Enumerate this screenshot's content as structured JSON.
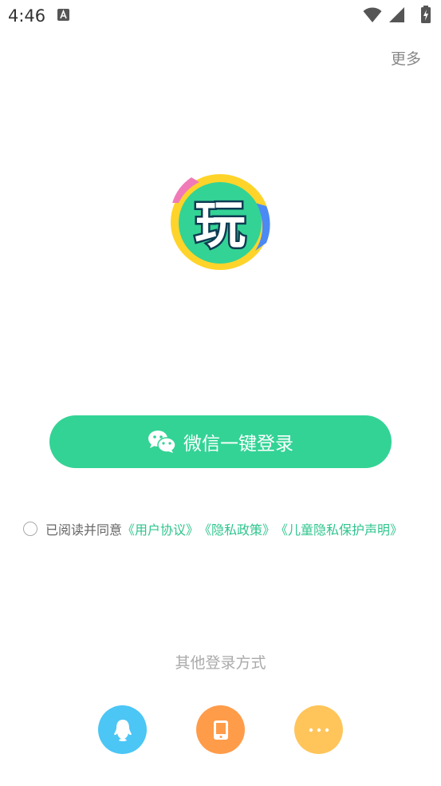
{
  "status_bar": {
    "time": "4:46",
    "indicator_icon": "text-a-icon",
    "right_icons": [
      "wifi-icon",
      "signal-icon",
      "battery-icon"
    ]
  },
  "header": {
    "more_label": "更多"
  },
  "logo": {
    "glyph": "玩",
    "colors": {
      "ring_yellow": "#ffd42a",
      "ring_pink": "#f07ab8",
      "ring_blue": "#4b89f5",
      "inner_green": "#33d395",
      "stroke": "#0d3c52"
    }
  },
  "login": {
    "wechat_button_label": "微信一键登录",
    "wechat_icon": "wechat-icon",
    "accent": "#33d395"
  },
  "agreement": {
    "prefix": "已阅读并同意",
    "links": [
      "《用户协议》",
      "《隐私政策》",
      "《儿童隐私保护声明》"
    ],
    "checked": false
  },
  "other_login": {
    "title": "其他登录方式",
    "options": [
      {
        "icon": "qq-icon",
        "color": "#4bc6f5"
      },
      {
        "icon": "phone-icon",
        "color": "#ff9c4a"
      },
      {
        "icon": "more-dots-icon",
        "color": "#ffc55a"
      }
    ]
  }
}
